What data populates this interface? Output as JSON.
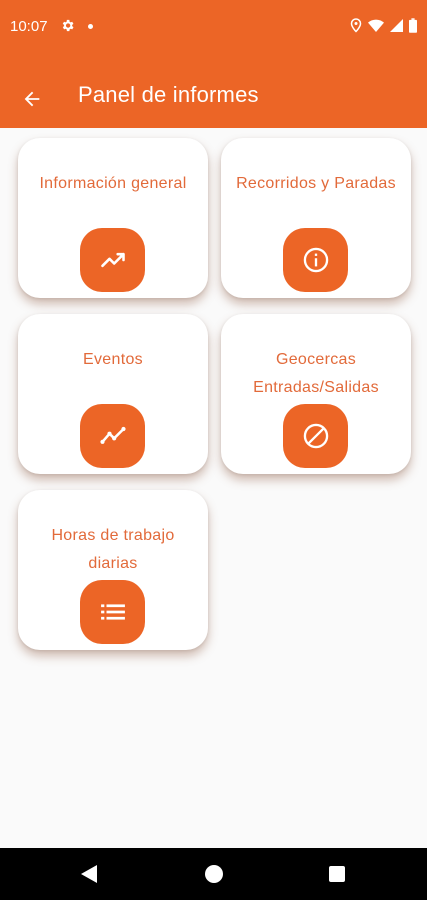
{
  "status_bar": {
    "time": "10:07",
    "icons": [
      "gear-icon",
      "dot-icon",
      "location-icon",
      "wifi-icon",
      "signal-icon",
      "battery-icon"
    ]
  },
  "app_bar": {
    "title": "Panel de informes",
    "back_icon": "arrow-left-icon",
    "color": "#ec6526"
  },
  "cards": [
    {
      "label": "Información general",
      "icon": "trending-up-icon"
    },
    {
      "label": "Recorridos y Paradas",
      "icon": "info-circle-icon"
    },
    {
      "label": "Eventos",
      "icon": "chart-line-icon"
    },
    {
      "label": "Geocercas Entradas/Salidas",
      "icon": "block-icon"
    },
    {
      "label": "Horas de trabajo diarias",
      "icon": "list-icon"
    }
  ],
  "colors": {
    "accent": "#ec6526",
    "label_text": "#e26a3a",
    "background": "#fafafa"
  },
  "nav_bar": {
    "buttons": [
      "back-triangle-icon",
      "home-circle-icon",
      "recents-square-icon"
    ]
  }
}
